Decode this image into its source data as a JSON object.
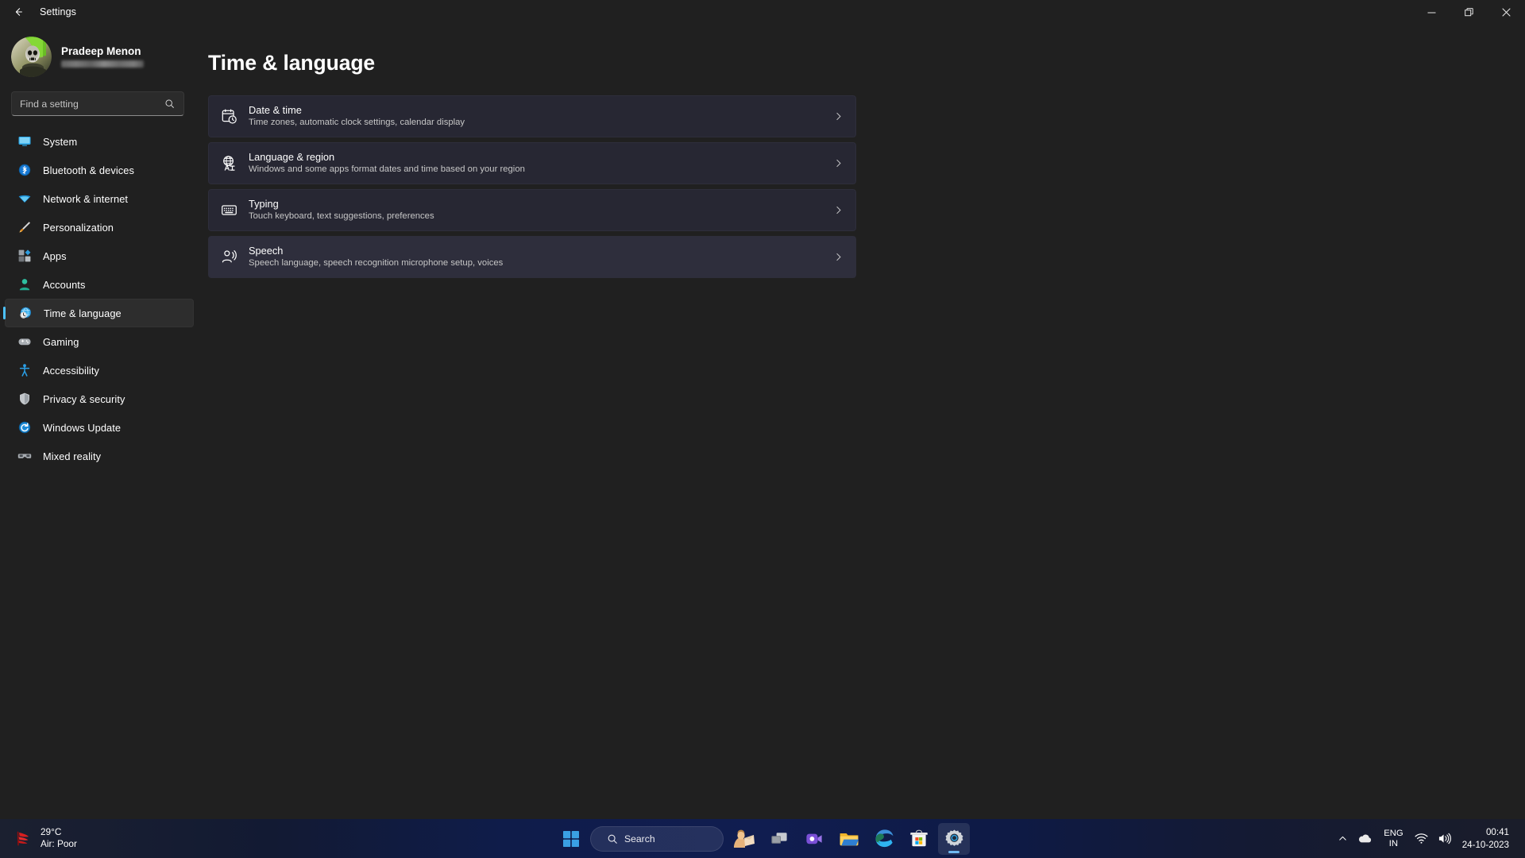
{
  "window": {
    "title": "Settings",
    "back_icon": "back-arrow-icon",
    "minimize_label": "Minimize",
    "maximize_label": "Maximize",
    "close_label": "Close"
  },
  "account": {
    "name": "Pradeep Menon",
    "email_masked": "",
    "avatar_alt": "user-avatar"
  },
  "search": {
    "placeholder": "Find a setting",
    "value": "",
    "icon": "search-icon"
  },
  "sidebar": {
    "items": [
      {
        "label": "System",
        "icon": "monitor-icon",
        "active": false
      },
      {
        "label": "Bluetooth & devices",
        "icon": "bluetooth-icon",
        "active": false
      },
      {
        "label": "Network & internet",
        "icon": "wifi-icon",
        "active": false
      },
      {
        "label": "Personalization",
        "icon": "paintbrush-icon",
        "active": false
      },
      {
        "label": "Apps",
        "icon": "apps-icon",
        "active": false
      },
      {
        "label": "Accounts",
        "icon": "person-icon",
        "active": false
      },
      {
        "label": "Time & language",
        "icon": "clock-globe-icon",
        "active": true
      },
      {
        "label": "Gaming",
        "icon": "gamepad-icon",
        "active": false
      },
      {
        "label": "Accessibility",
        "icon": "accessibility-icon",
        "active": false
      },
      {
        "label": "Privacy & security",
        "icon": "shield-icon",
        "active": false
      },
      {
        "label": "Windows Update",
        "icon": "update-icon",
        "active": false
      },
      {
        "label": "Mixed reality",
        "icon": "vr-headset-icon",
        "active": false
      }
    ]
  },
  "page": {
    "title": "Time & language",
    "cards": [
      {
        "title": "Date & time",
        "subtitle": "Time zones, automatic clock settings, calendar display",
        "icon": "calendar-clock-icon",
        "hovered": false
      },
      {
        "title": "Language & region",
        "subtitle": "Windows and some apps format dates and time based on your region",
        "icon": "globe-language-icon",
        "hovered": false
      },
      {
        "title": "Typing",
        "subtitle": "Touch keyboard, text suggestions, preferences",
        "icon": "keyboard-icon",
        "hovered": false
      },
      {
        "title": "Speech",
        "subtitle": "Speech language, speech recognition microphone setup, voices",
        "icon": "speech-icon",
        "hovered": true
      }
    ],
    "chevron_icon": "chevron-right-icon"
  },
  "taskbar": {
    "weather": {
      "temperature": "29°C",
      "air_quality": "Air: Poor",
      "icon": "weather-alert-icon"
    },
    "start_label": "Start",
    "search": {
      "label": "Search",
      "icon": "search-icon"
    },
    "apps": [
      {
        "name": "copilot-icon",
        "label": "Copilot",
        "running": false
      },
      {
        "name": "task-view-icon",
        "label": "Task View",
        "running": false
      },
      {
        "name": "teams-icon",
        "label": "Chat",
        "running": false
      },
      {
        "name": "file-explorer-icon",
        "label": "File Explorer",
        "running": false
      },
      {
        "name": "edge-icon",
        "label": "Microsoft Edge",
        "running": true
      },
      {
        "name": "microsoft-store-icon",
        "label": "Microsoft Store",
        "running": false
      },
      {
        "name": "settings-icon",
        "label": "Settings",
        "running": true
      }
    ],
    "tray": {
      "chevron_label": "Show hidden icons",
      "onedrive_label": "OneDrive",
      "language_line1": "ENG",
      "language_line2": "IN",
      "wifi_label": "Network",
      "volume_label": "Volume",
      "time": "00:41",
      "date": "24-10-2023"
    }
  },
  "colors": {
    "app_background": "#202020",
    "card_background": "#272733",
    "accent": "#4cc2ff",
    "taskbar_blue": "#101d50"
  }
}
